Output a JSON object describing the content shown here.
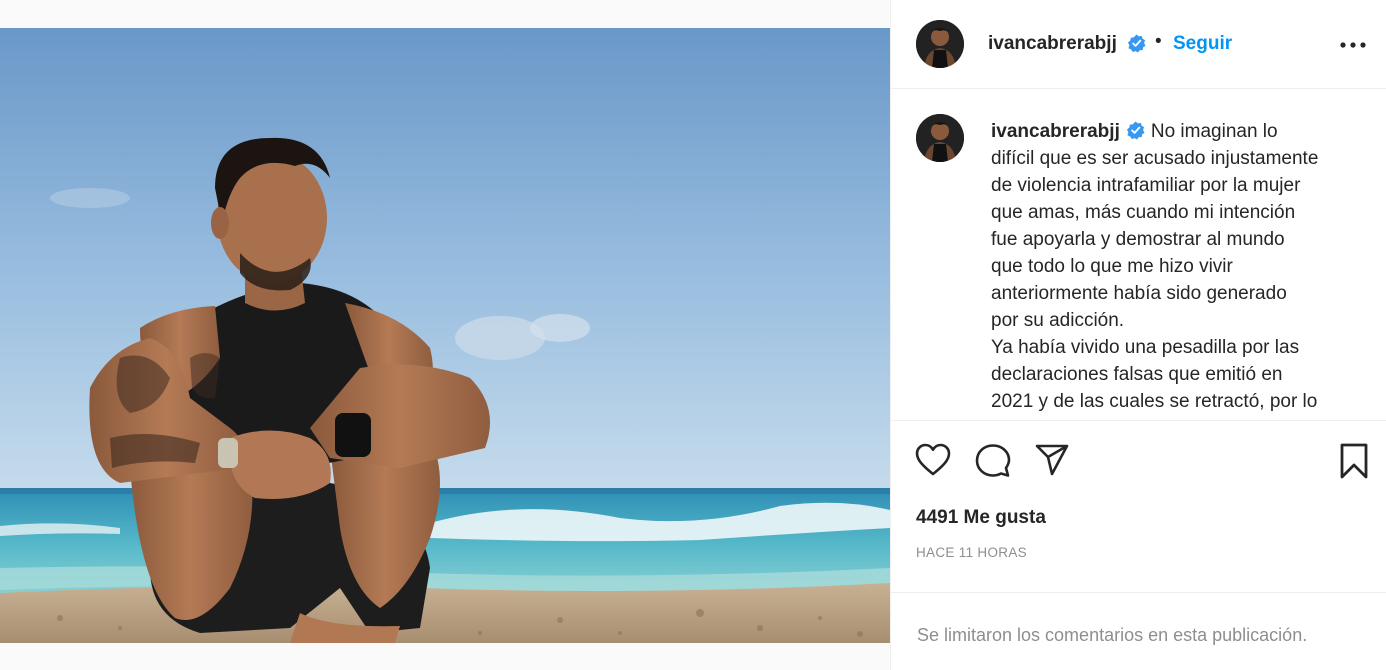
{
  "post": {
    "username": "ivancabrerabjj",
    "verified": true,
    "dot": "•",
    "follow_label": "Seguir",
    "more_icon": "more-horizontal-icon",
    "caption_lines": [
      "No imaginan lo",
      "difícil que es ser acusado injustamente",
      "de violencia intrafamiliar por la mujer",
      "que amas, más cuando mi intención",
      "fue apoyarla y demostrar al mundo",
      "que todo lo que me hizo vivir",
      "anteriormente había sido generado",
      "por su adicción.",
      "Ya había vivido una pesadilla por las",
      "declaraciones falsas que emitió en",
      "2021 y de las cuales se retractó, por lo"
    ],
    "likes": "4491 Me gusta",
    "timestamp": "HACE 11 HORAS",
    "comments_note": "Se limitaron los comentarios en esta publicación."
  },
  "icons": {
    "like": "heart-icon",
    "comment": "comment-icon",
    "share": "share-icon",
    "save": "bookmark-icon",
    "verified": "verified-badge-icon"
  },
  "colors": {
    "link_blue": "#0095f6",
    "verified_blue": "#3897f0",
    "text": "#262626",
    "secondary": "#8e8e8e",
    "border": "#efefef"
  }
}
